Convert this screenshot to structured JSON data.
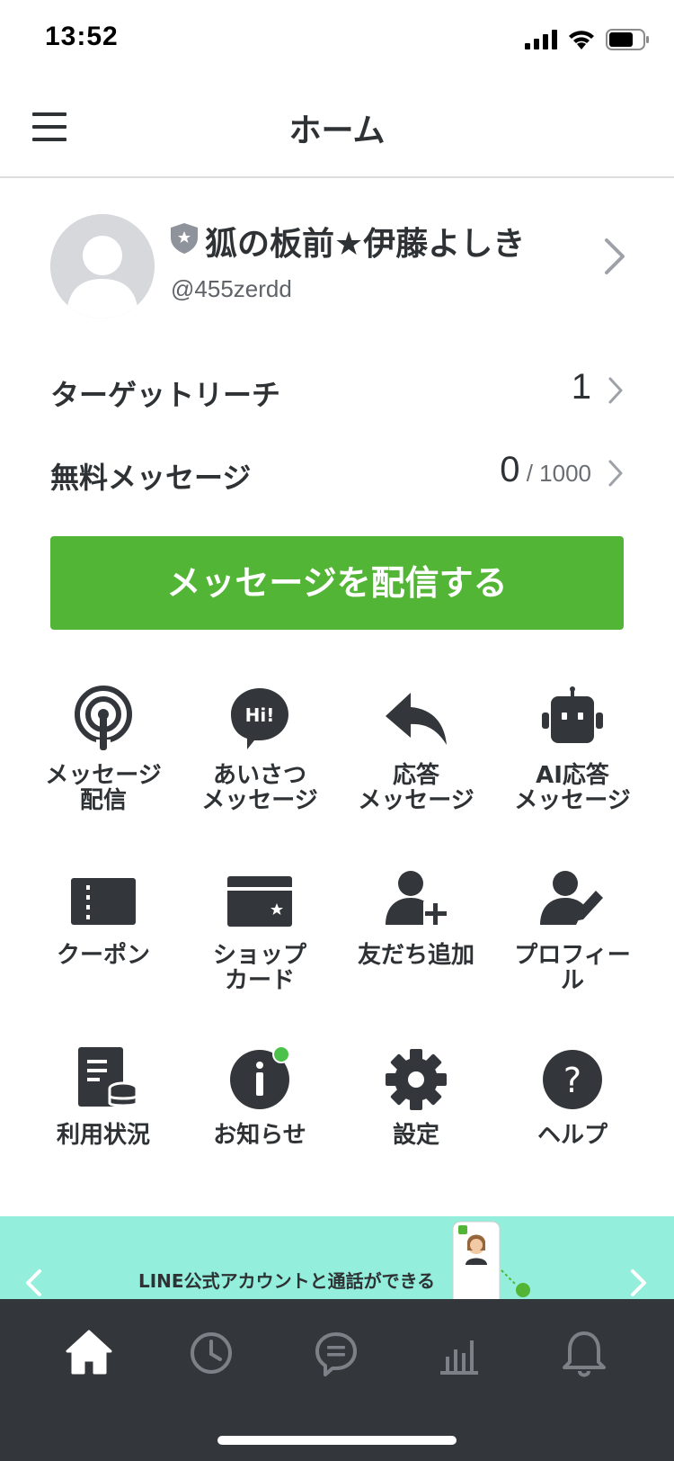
{
  "status_bar": {
    "time": "13:52"
  },
  "header": {
    "title": "ホーム"
  },
  "profile": {
    "name": "狐の板前★伊藤よしき",
    "id": "@455zerdd"
  },
  "stats": {
    "target_reach": {
      "label": "ターゲットリーチ",
      "value": "1"
    },
    "free_messages": {
      "label": "無料メッセージ",
      "value": "0",
      "max": " / 1000"
    }
  },
  "send_button": {
    "label": "メッセージを配信する"
  },
  "menu": {
    "items": [
      {
        "label": "メッセージ\n配信",
        "icon": "broadcast-icon"
      },
      {
        "label": "あいさつ\nメッセージ",
        "icon": "hi-bubble-icon"
      },
      {
        "label": "応答\nメッセージ",
        "icon": "reply-icon"
      },
      {
        "label": "AI応答\nメッセージ",
        "icon": "robot-icon"
      },
      {
        "label": "クーポン",
        "icon": "coupon-icon"
      },
      {
        "label": "ショップ\nカード",
        "icon": "shop-card-icon"
      },
      {
        "label": "友だち追加",
        "icon": "add-friend-icon"
      },
      {
        "label": "プロフィー\nル",
        "icon": "profile-edit-icon"
      },
      {
        "label": "利用状況",
        "icon": "usage-icon"
      },
      {
        "label": "お知らせ",
        "icon": "info-icon"
      },
      {
        "label": "設定",
        "icon": "gear-icon"
      },
      {
        "label": "ヘルプ",
        "icon": "help-icon"
      }
    ]
  },
  "banner": {
    "text": "LINE公式アカウントと通話ができる"
  },
  "tab_bar": {
    "tabs": [
      "home-icon",
      "clock-icon",
      "chat-icon",
      "analytics-icon",
      "bell-icon"
    ],
    "active": "home-icon"
  },
  "colors": {
    "accent_green": "#53b535",
    "banner_bg": "#93eedb",
    "tab_bar_bg": "#33373b",
    "notification_dot": "#4cc24c"
  }
}
